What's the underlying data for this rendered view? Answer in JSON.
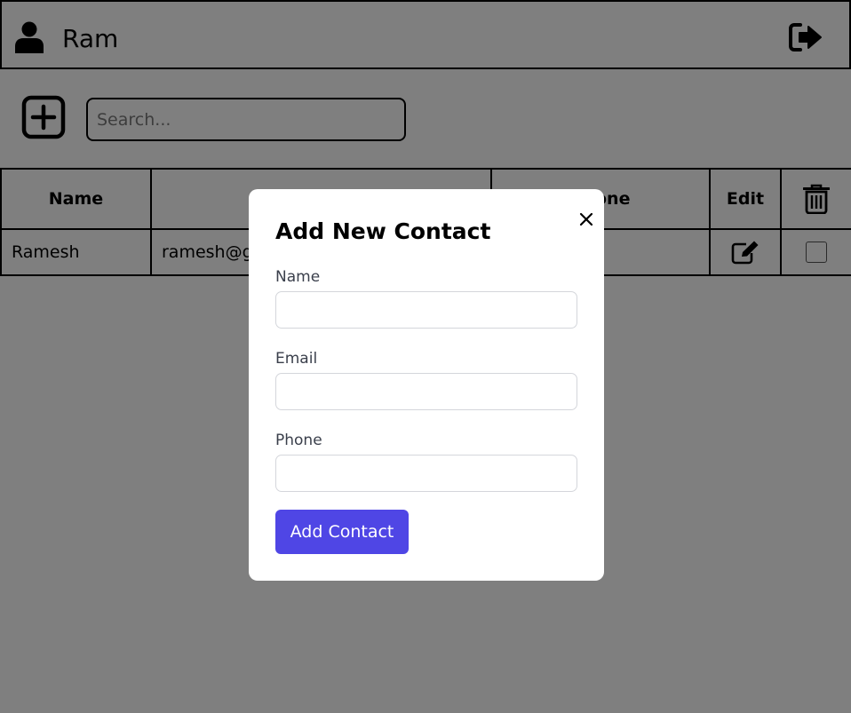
{
  "header": {
    "user_name": "Ram",
    "user_icon": "user-icon",
    "logout_icon": "logout-icon"
  },
  "toolbar": {
    "add_icon": "plus-square-icon",
    "search_placeholder": "Search..."
  },
  "table": {
    "headers": [
      "Name",
      "",
      "Phone",
      "Edit"
    ],
    "delete_header_icon": "trash-icon",
    "rows": [
      {
        "name": "Ramesh",
        "email": "ramesh@gmail.com",
        "phone": "",
        "edit_icon": "edit-icon",
        "checked": false
      }
    ]
  },
  "modal": {
    "title": "Add New Contact",
    "close_icon": "close-icon",
    "fields": [
      {
        "label": "Name",
        "value": "",
        "placeholder": ""
      },
      {
        "label": "Email",
        "value": "",
        "placeholder": ""
      },
      {
        "label": "Phone",
        "value": "",
        "placeholder": ""
      }
    ],
    "submit_label": "Add Contact"
  },
  "colors": {
    "primary_button": "#4f46e5",
    "overlay": "rgba(0,0,0,0.5)",
    "border": "#000000"
  }
}
